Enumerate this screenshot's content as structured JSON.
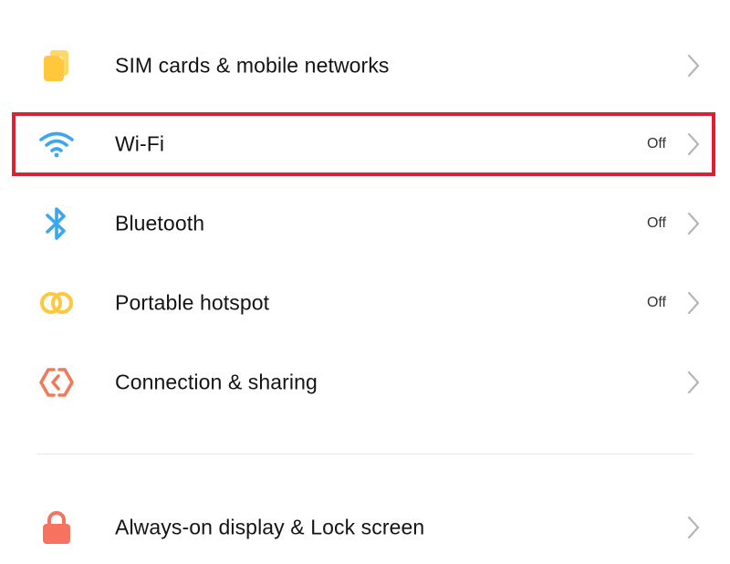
{
  "settings": {
    "items": [
      {
        "label": "SIM cards & mobile networks",
        "status": "",
        "icon": "sim-card-icon",
        "color": "#FFC83C"
      },
      {
        "label": "Wi-Fi",
        "status": "Off",
        "icon": "wifi-icon",
        "color": "#3AA7F0",
        "highlighted": true
      },
      {
        "label": "Bluetooth",
        "status": "Off",
        "icon": "bluetooth-icon",
        "color": "#3AA7F0"
      },
      {
        "label": "Portable hotspot",
        "status": "Off",
        "icon": "hotspot-icon",
        "color": "#FFC83C"
      },
      {
        "label": "Connection & sharing",
        "status": "",
        "icon": "connection-sharing-icon",
        "color": "#F07A5A"
      },
      {
        "label": "Always-on display & Lock screen",
        "status": "",
        "icon": "lock-icon",
        "color": "#F7735F"
      }
    ]
  },
  "highlight_color": "#E02030"
}
